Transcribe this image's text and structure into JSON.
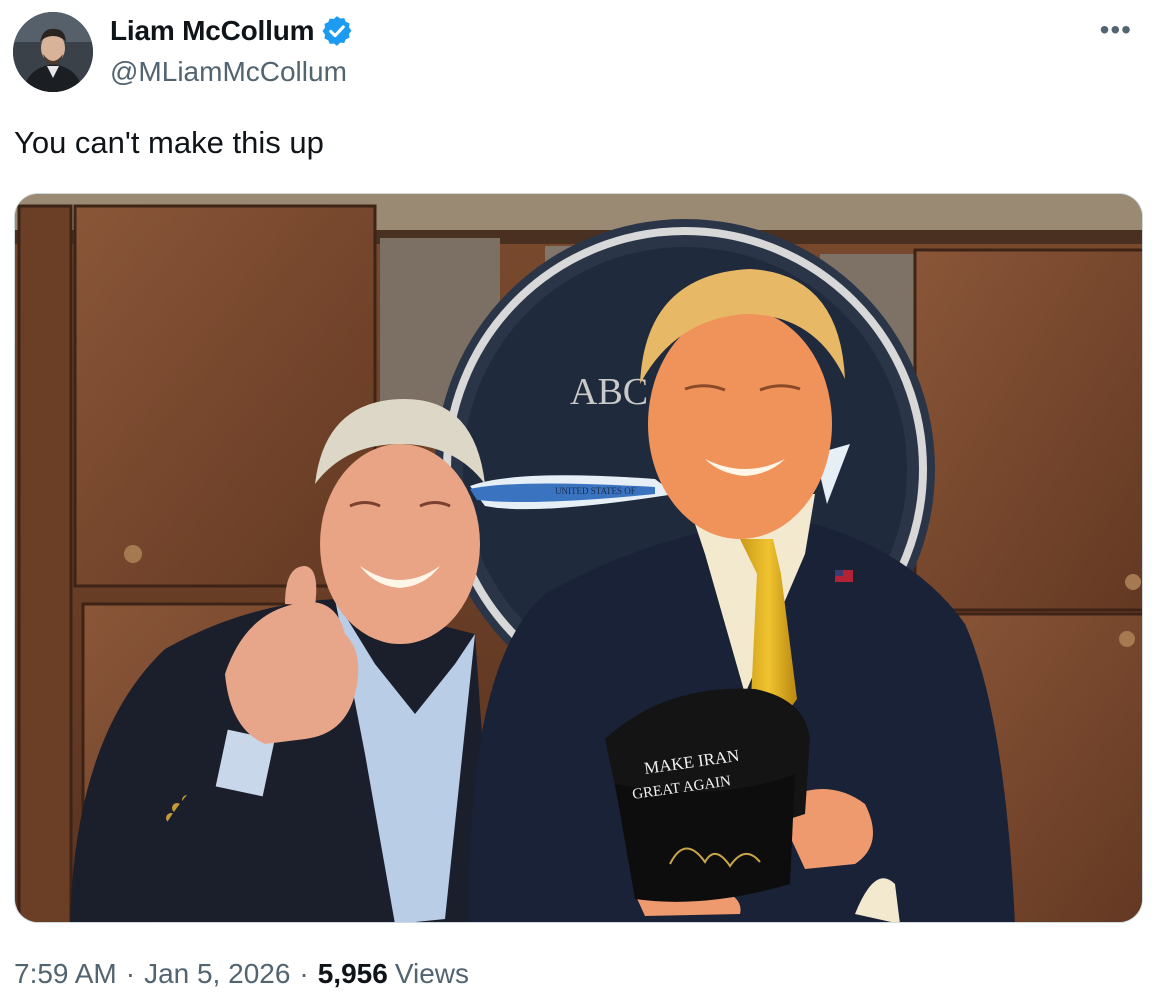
{
  "author": {
    "display_name": "Liam McCollum",
    "handle": "@MLiamMcCollum",
    "verified": true,
    "avatar_icon": "profile-photo"
  },
  "more_icon": "more-horizontal-icon",
  "tweet": {
    "text": "You can't make this up"
  },
  "media": {
    "seal_text": "ABC",
    "plane_text": "UNITED STATES OF",
    "hat_line1": "MAKE IRAN",
    "hat_line2": "GREAT AGAIN"
  },
  "meta": {
    "time": "7:59 AM",
    "dot": "·",
    "date": "Jan 5, 2026",
    "views_count": "5,956",
    "views_label": "Views"
  },
  "colors": {
    "verified_blue": "#1d9bf0",
    "secondary_text": "#536471",
    "primary_text": "#0f1419"
  }
}
